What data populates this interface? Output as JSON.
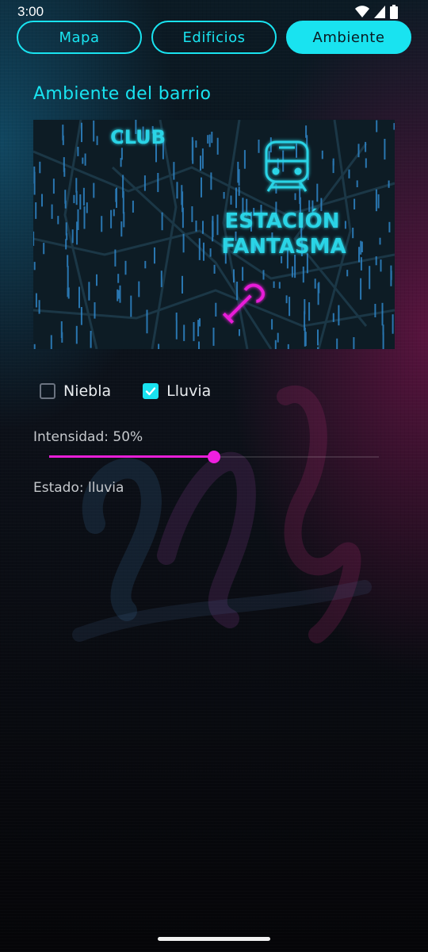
{
  "status_bar": {
    "time": "3:00",
    "icons": [
      "wifi-icon",
      "signal-icon",
      "battery-icon"
    ]
  },
  "tabs": [
    {
      "label": "Mapa",
      "active": false
    },
    {
      "label": "Edificios",
      "active": false
    },
    {
      "label": "Ambiente",
      "active": true
    }
  ],
  "section": {
    "title": "Ambiente del barrio"
  },
  "map": {
    "labels": {
      "club": "CLUB",
      "station_line1": "ESTACIÓN",
      "station_line2": "FANTASMA"
    },
    "icons": [
      "train-icon",
      "wrench-icon"
    ]
  },
  "toggles": [
    {
      "label": "Niebla",
      "checked": false
    },
    {
      "label": "Lluvia",
      "checked": true
    }
  ],
  "intensity": {
    "label": "Intensidad: 50%",
    "value": 0.5
  },
  "state": {
    "label": "Estado: lluvia"
  },
  "colors": {
    "accent_cyan": "#19e3f0",
    "accent_magenta": "#e81ed8"
  }
}
